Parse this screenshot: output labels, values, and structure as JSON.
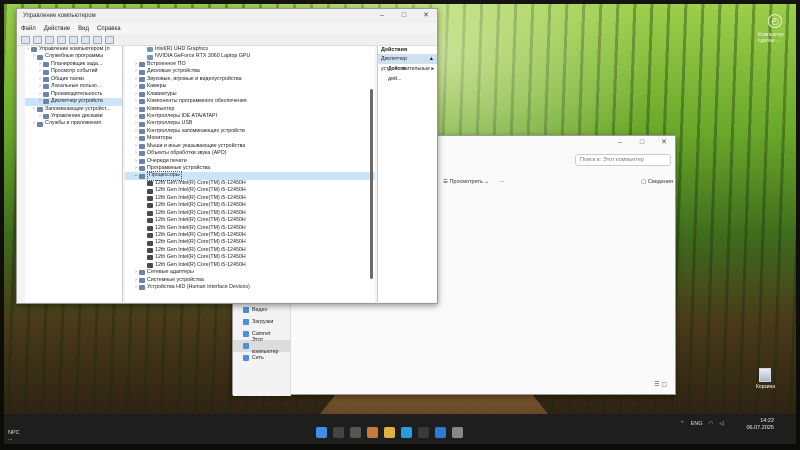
{
  "device_manager": {
    "title": "Управление компьютером",
    "menu": [
      "Файл",
      "Действие",
      "Вид",
      "Справка"
    ],
    "left_tree": [
      {
        "label": "Управление компьютером (л",
        "indent": 0
      },
      {
        "label": "Служебные программы",
        "indent": 1
      },
      {
        "label": "Планировщик зада...",
        "indent": 2
      },
      {
        "label": "Просмотр событий",
        "indent": 2
      },
      {
        "label": "Общие папки",
        "indent": 2
      },
      {
        "label": "Локальные пользо...",
        "indent": 2
      },
      {
        "label": "Производительность",
        "indent": 2
      },
      {
        "label": "Диспетчер устройств",
        "indent": 2,
        "selected": true
      },
      {
        "label": "Запоминающие устройст...",
        "indent": 1
      },
      {
        "label": "Управление дисками",
        "indent": 2
      },
      {
        "label": "Службы и приложения",
        "indent": 1
      }
    ],
    "tree": [
      {
        "label": "Intel(R) UHD Graphics",
        "type": "dev",
        "indent": 2
      },
      {
        "label": "NVIDIA GeForce RTX 3060 Laptop GPU",
        "type": "dev",
        "indent": 2
      },
      {
        "label": "Встроенное ПО",
        "type": "cat",
        "indent": 1
      },
      {
        "label": "Дисковые устройства",
        "type": "cat",
        "indent": 1
      },
      {
        "label": "Звуковые, игровые и видеоустройства",
        "type": "cat",
        "indent": 1
      },
      {
        "label": "Камеры",
        "type": "cat",
        "indent": 1
      },
      {
        "label": "Клавиатуры",
        "type": "cat",
        "indent": 1
      },
      {
        "label": "Компоненты программного обеспечения",
        "type": "cat",
        "indent": 1
      },
      {
        "label": "Компьютер",
        "type": "cat",
        "indent": 1
      },
      {
        "label": "Контроллеры IDE ATA/ATAPI",
        "type": "cat",
        "indent": 1
      },
      {
        "label": "Контроллеры USB",
        "type": "cat",
        "indent": 1
      },
      {
        "label": "Контроллеры запоминающих устройств",
        "type": "cat",
        "indent": 1
      },
      {
        "label": "Мониторы",
        "type": "cat",
        "indent": 1
      },
      {
        "label": "Мыши и иные указывающие устройства",
        "type": "cat",
        "indent": 1
      },
      {
        "label": "Объекты обработки звука (APO)",
        "type": "cat",
        "indent": 1
      },
      {
        "label": "Очереди печати",
        "type": "cat",
        "indent": 1
      },
      {
        "label": "Программные устройства",
        "type": "cat",
        "indent": 1
      },
      {
        "label": "Процессоры",
        "type": "open",
        "indent": 1,
        "selected": true
      },
      {
        "label": "12th Gen Intel(R) Core(TM) i5-12450H",
        "type": "cpu",
        "indent": 2
      },
      {
        "label": "12th Gen Intel(R) Core(TM) i5-12450H",
        "type": "cpu",
        "indent": 2
      },
      {
        "label": "12th Gen Intel(R) Core(TM) i5-12450H",
        "type": "cpu",
        "indent": 2
      },
      {
        "label": "12th Gen Intel(R) Core(TM) i5-12450H",
        "type": "cpu",
        "indent": 2
      },
      {
        "label": "12th Gen Intel(R) Core(TM) i5-12450H",
        "type": "cpu",
        "indent": 2
      },
      {
        "label": "12th Gen Intel(R) Core(TM) i5-12450H",
        "type": "cpu",
        "indent": 2
      },
      {
        "label": "12th Gen Intel(R) Core(TM) i5-12450H",
        "type": "cpu",
        "indent": 2
      },
      {
        "label": "12th Gen Intel(R) Core(TM) i5-12450H",
        "type": "cpu",
        "indent": 2
      },
      {
        "label": "12th Gen Intel(R) Core(TM) i5-12450H",
        "type": "cpu",
        "indent": 2
      },
      {
        "label": "12th Gen Intel(R) Core(TM) i5-12450H",
        "type": "cpu",
        "indent": 2
      },
      {
        "label": "12th Gen Intel(R) Core(TM) i5-12450H",
        "type": "cpu",
        "indent": 2
      },
      {
        "label": "12th Gen Intel(R) Core(TM) i5-12450H",
        "type": "cpu",
        "indent": 2
      },
      {
        "label": "Сетевые адаптеры",
        "type": "cat",
        "indent": 1
      },
      {
        "label": "Системные устройства",
        "type": "cat",
        "indent": 1
      },
      {
        "label": "Устройства HID (Human Interface Devices)",
        "type": "cat",
        "indent": 1
      }
    ],
    "actions": {
      "header": "Действия",
      "selected": "Диспетчер устройств",
      "more": "Дополнительные дей..."
    }
  },
  "explorer": {
    "search_placeholder": "Поиск в: Этот компьютер",
    "view_label": "Просмотреть",
    "more_label": "···",
    "details_label": "Сведения",
    "nav": [
      {
        "label": "Видео"
      },
      {
        "label": "Загрузки"
      },
      {
        "label": "Camnet"
      },
      {
        "label": "Этот компьютер",
        "selected": true
      },
      {
        "label": "Сеть"
      }
    ]
  },
  "desktop": {
    "corner_text": "Компьютер сделан ...",
    "recycle_bin": "Корзина"
  },
  "taskbar": {
    "left_title": "NPC",
    "left_sub": "...",
    "tray_lang": "ENG",
    "time": "14:22",
    "date": "06.07.2025"
  }
}
